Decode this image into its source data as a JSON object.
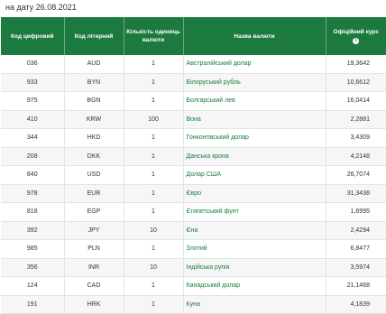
{
  "date_line": "на дату 26.08.2021",
  "table": {
    "headers": {
      "digital_code": "Код цифровий",
      "letter_code": "Код літерний",
      "units": "Кількість одиниць валюти",
      "name": "Назва валюти",
      "rate": "Офіційний курс"
    },
    "info_icon": "i",
    "rows": [
      {
        "digital": "036",
        "letter": "AUD",
        "units": "1",
        "name": "Австралійський долар",
        "rate": "19,3642"
      },
      {
        "digital": "933",
        "letter": "BYN",
        "units": "1",
        "name": "Білоруський рубль",
        "rate": "10,6612"
      },
      {
        "digital": "975",
        "letter": "BGN",
        "units": "1",
        "name": "Болгарський лев",
        "rate": "16,0414"
      },
      {
        "digital": "410",
        "letter": "KRW",
        "units": "100",
        "name": "Вона",
        "rate": "2,2881"
      },
      {
        "digital": "344",
        "letter": "HKD",
        "units": "1",
        "name": "Гонконгівський долар",
        "rate": "3,4309"
      },
      {
        "digital": "208",
        "letter": "DKK",
        "units": "1",
        "name": "Данська крона",
        "rate": "4,2148"
      },
      {
        "digital": "840",
        "letter": "USD",
        "units": "1",
        "name": "Долар США",
        "rate": "26,7074"
      },
      {
        "digital": "978",
        "letter": "EUR",
        "units": "1",
        "name": "Євро",
        "rate": "31,3438"
      },
      {
        "digital": "818",
        "letter": "EGP",
        "units": "1",
        "name": "Єгипетський фунт",
        "rate": "1,6995"
      },
      {
        "digital": "392",
        "letter": "JPY",
        "units": "10",
        "name": "Єна",
        "rate": "2,4294"
      },
      {
        "digital": "985",
        "letter": "PLN",
        "units": "1",
        "name": "Злотий",
        "rate": "6,8477"
      },
      {
        "digital": "356",
        "letter": "INR",
        "units": "10",
        "name": "Індійська рупія",
        "rate": "3,5974"
      },
      {
        "digital": "124",
        "letter": "CAD",
        "units": "1",
        "name": "Канадський долар",
        "rate": "21,1468"
      },
      {
        "digital": "191",
        "letter": "HRK",
        "units": "1",
        "name": "Куна",
        "rate": "4,1839"
      }
    ]
  },
  "colors": {
    "header_bg": "#1c7a3f",
    "link": "#1c7a3f"
  }
}
